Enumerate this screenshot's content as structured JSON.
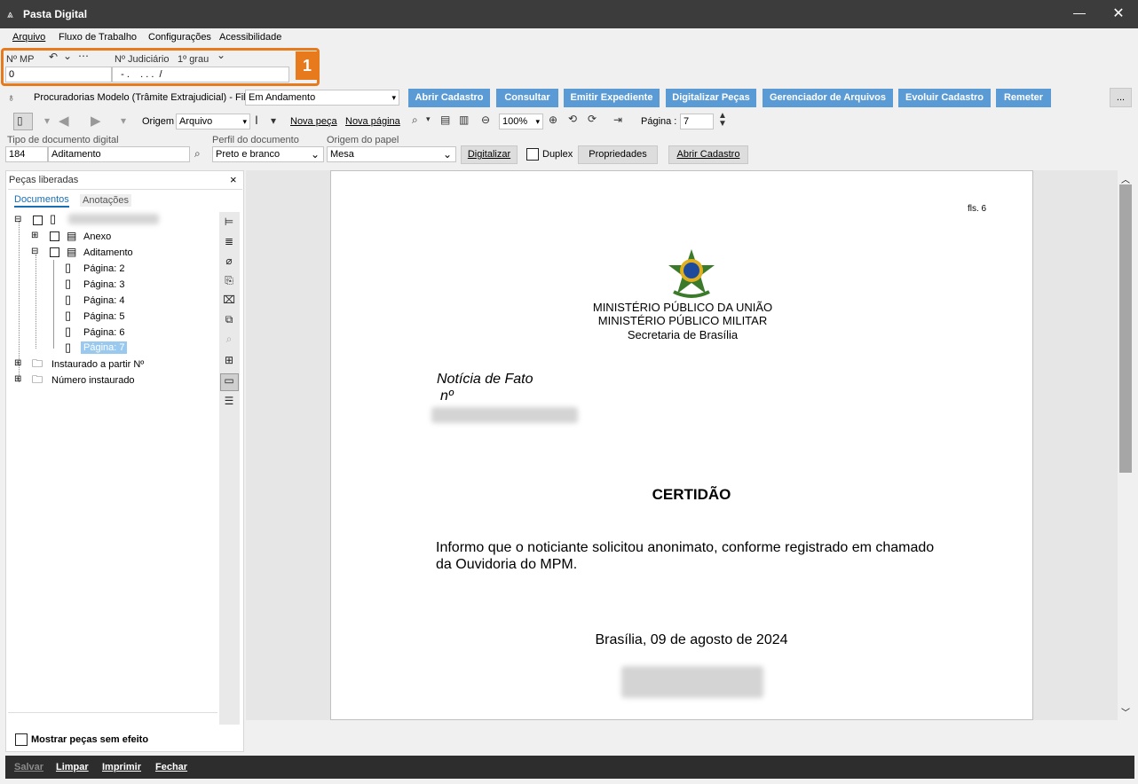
{
  "window": {
    "title": "Pasta Digital",
    "minimize": "—",
    "close": "✕"
  },
  "menu": [
    "Arquivo",
    "Fluxo de Trabalho",
    "Configurações",
    "Acessibilidade"
  ],
  "header": {
    "nmp_label": "Nº MP",
    "nmp_value": "0",
    "judicial_label": "Nº Judiciário",
    "grau_label": "1º grau",
    "judicial_mask": "  - .    . . .  /",
    "annotation_badge": "1"
  },
  "queue": {
    "label": "Procuradorias Modelo (Trâmite Extrajudicial) - Fila",
    "value": "Em Andamento"
  },
  "actions": [
    "Abrir Cadastro",
    "Consultar",
    "Emitir Expediente",
    "Digitalizar Peças",
    "Gerenciador de Arquivos",
    "Evoluir Cadastro",
    "Remeter"
  ],
  "more_button": "...",
  "toolbar": {
    "origem_label": "Origem",
    "origem_value": "Arquivo",
    "nova_peca": "Nova peça",
    "nova_pagina": "Nova página",
    "zoom_value": "100%",
    "pagina_label": "Página :",
    "pagina_value": "7"
  },
  "fields": {
    "tipo_label": "Tipo de documento digital",
    "tipo_code": "184",
    "tipo_value": "Aditamento",
    "perfil_label": "Perfil do documento",
    "perfil_value": "Preto e branco",
    "origem_papel_label": "Origem do papel",
    "origem_papel_value": "Mesa",
    "digitalizar": "Digitalizar",
    "duplex": "Duplex",
    "propriedades": "Propriedades",
    "abrir_cadastro": "Abrir Cadastro"
  },
  "left_panel": {
    "title": "Peças liberadas",
    "close": "×",
    "tabs": [
      "Documentos",
      "Anotações"
    ],
    "tree": {
      "anexo": "Anexo",
      "aditamento": "Aditamento",
      "pages": [
        "Página: 2",
        "Página: 3",
        "Página: 4",
        "Página: 5",
        "Página: 6",
        "Página: 7"
      ],
      "instaurado": "Instaurado a partir Nº",
      "numero": "Número instaurado"
    },
    "show_no_effect": "Mostrar peças sem efeito"
  },
  "document": {
    "fls": "fls. 6",
    "org1": "MINISTÉRIO PÚBLICO DA UNIÃO",
    "org2": "MINISTÉRIO PÚBLICO MILITAR",
    "org3": "Secretaria de Brasília",
    "noticia": "Notícia de Fato",
    "numero": "nº",
    "heading": "CERTIDÃO",
    "body1": "Informo que o noticiante solicitou anonimato, conforme registrado em chamado",
    "body2": "da Ouvidoria do MPM.",
    "date": "Brasília, 09 de agosto de 2024"
  },
  "footer": [
    "Salvar",
    "Limpar",
    "Imprimir",
    "Fechar"
  ],
  "colors": {
    "accent_blue": "#5b9bd5",
    "highlight": "#e87a1e",
    "titlebar": "#3c3c3c",
    "selection": "#99c9ef"
  }
}
